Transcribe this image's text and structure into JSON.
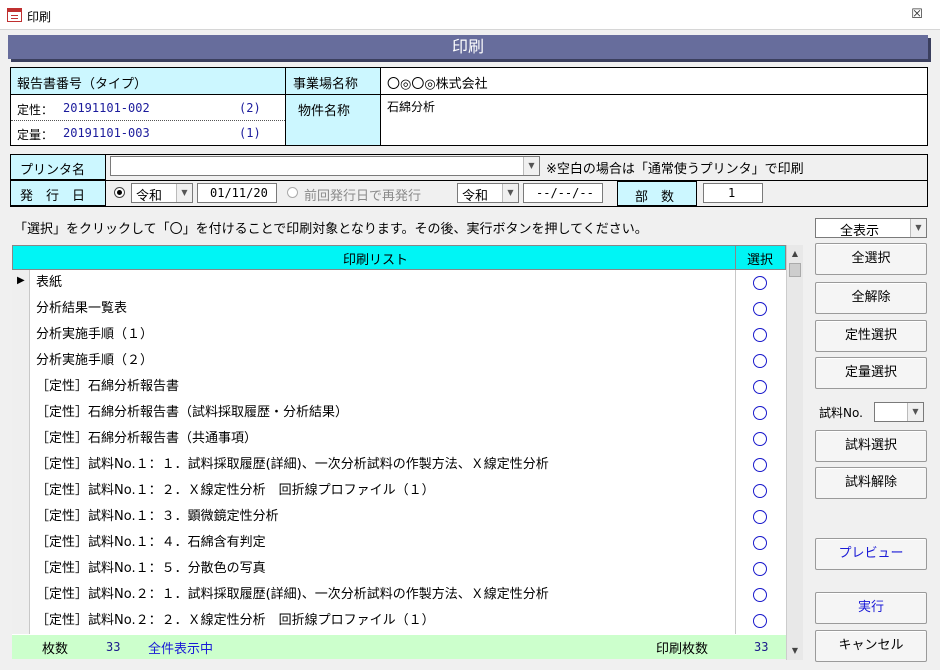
{
  "window": {
    "title": "印刷",
    "close": "☒"
  },
  "header": {
    "title": "印刷"
  },
  "report": {
    "label": "報告書番号（タイプ）",
    "rows": [
      {
        "kind": "定性：",
        "number": "20191101-002",
        "count": "(2)"
      },
      {
        "kind": "定量：",
        "number": "20191101-003",
        "count": "(1)"
      }
    ]
  },
  "site": {
    "label": "事業場名称",
    "value": "〇◎〇◎株式会社"
  },
  "property": {
    "label": "物件名称",
    "value": "石綿分析"
  },
  "printer": {
    "label": "プリンタ名",
    "value": "",
    "note": "※空白の場合は「通常使うプリンタ」で印刷"
  },
  "issue": {
    "label": "発　行　日",
    "era": "令和",
    "date": "01/11/20",
    "prev_label": "前回発行日で再発行",
    "prev_era": "令和",
    "prev_date": "--/--/--",
    "copies_label": "部　数",
    "copies": "1"
  },
  "instruction": "「選択」をクリックして「〇」を付けることで印刷対象となります。その後、実行ボタンを押してください。",
  "filter": {
    "value": "全表示"
  },
  "list": {
    "header_name": "印刷リスト",
    "header_select": "選択",
    "items": [
      "表紙",
      "分析結果一覧表",
      "分析実施手順（１）",
      "分析実施手順（２）",
      "［定性］石綿分析報告書",
      "［定性］石綿分析報告書（試料採取履歴・分析結果）",
      "［定性］石綿分析報告書（共通事項）",
      "［定性］試料No.１：１．試料採取履歴(詳細)、一次分析試料の作製方法、Ｘ線定性分析",
      "［定性］試料No.１：２．Ｘ線定性分析　回折線プロファイル（１）",
      "［定性］試料No.１：３．顕微鏡定性分析",
      "［定性］試料No.１：４．石綿含有判定",
      "［定性］試料No.１：５．分散色の写真",
      "［定性］試料No.２：１．試料採取履歴(詳細)、一次分析試料の作製方法、Ｘ線定性分析",
      "［定性］試料No.２：２．Ｘ線定性分析　回折線プロファイル（１）"
    ],
    "mark": "〇"
  },
  "footer": {
    "count_label": "枚数",
    "count": "33",
    "status": "全件表示中",
    "print_label": "印刷枚数",
    "print_count": "33"
  },
  "buttons": {
    "select_all": "全選択",
    "clear_all": "全解除",
    "qual_select": "定性選択",
    "quant_select": "定量選択",
    "sample_label": "試料No.",
    "sample_select": "試料選択",
    "sample_clear": "試料解除",
    "preview": "プレビュー",
    "execute": "実行",
    "cancel": "キャンセル"
  }
}
